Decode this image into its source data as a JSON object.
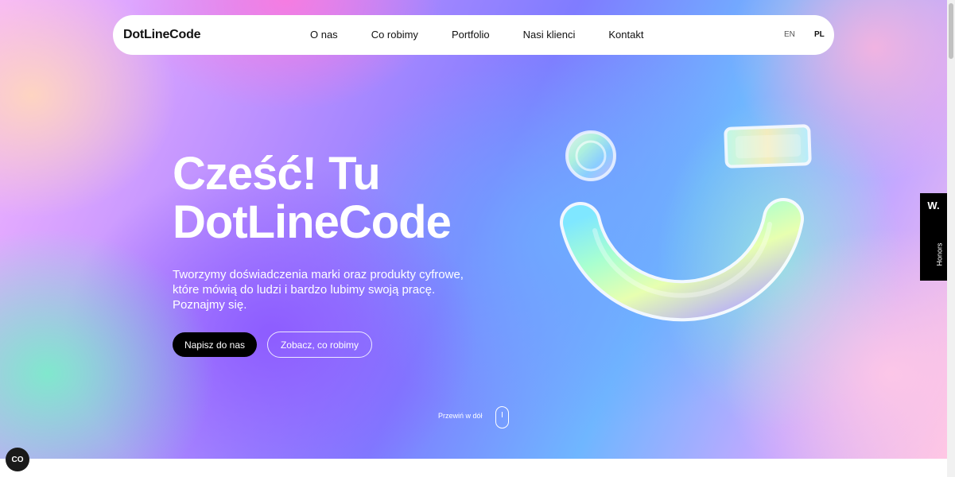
{
  "header": {
    "logo": "DotLineCode",
    "nav": [
      "O nas",
      "Co robimy",
      "Portfolio",
      "Nasi klienci",
      "Kontakt"
    ],
    "languages": {
      "en": "EN",
      "pl": "PL",
      "active": "PL"
    }
  },
  "hero": {
    "headline_line1": "Cześć! Tu",
    "headline_line2": "DotLineCode",
    "subtitle": "Tworzymy doświadczenia marki oraz produkty cyfrowe, które mówią do ludzi i bardzo lubimy swoją pracę. Poznajmy się.",
    "primary_button": "Napisz do nas",
    "secondary_button": "Zobacz, co robimy",
    "scroll_hint": "Przewiń w dół"
  },
  "honors": {
    "badge": "W.",
    "label": "Honors"
  },
  "cookie": {
    "label": "CO"
  },
  "colors": {
    "primary_button_bg": "#000000",
    "text_on_hero": "#ffffff"
  }
}
